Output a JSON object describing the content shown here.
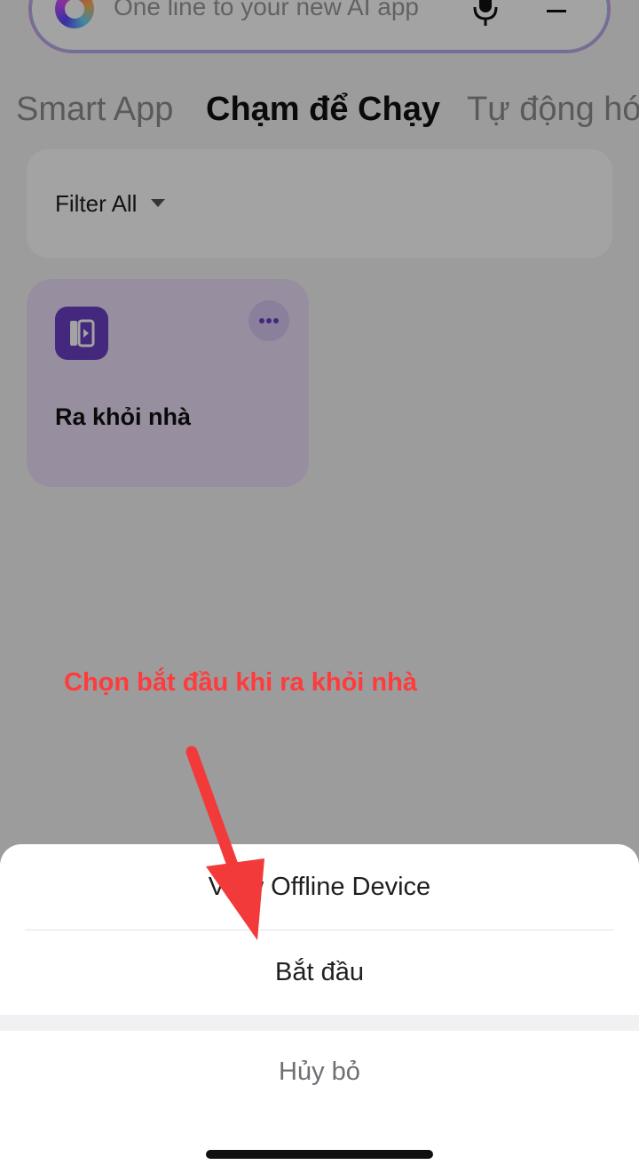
{
  "search": {
    "placeholder": "One line to your new AI app"
  },
  "tabs": [
    {
      "label": "Smart App"
    },
    {
      "label": "Chạm để Chạy"
    },
    {
      "label": "Tự động hóa"
    }
  ],
  "filter": {
    "label": "Filter All"
  },
  "shortcut": {
    "name": "Ra khỏi nhà"
  },
  "annotation": {
    "text": "Chọn bắt đầu khi ra khỏi nhà"
  },
  "sheet": {
    "option_offline": "View Offline Device",
    "option_start": "Bắt đầu",
    "cancel": "Hủy bỏ"
  },
  "colors": {
    "accent_purple": "#6a3fc4",
    "annotation_red": "#ff3b3b",
    "arrow_red": "#f23a3a"
  },
  "icons": [
    "app-logo-icon",
    "mic-icon",
    "menu-icon",
    "caret-down-icon",
    "shortcut-play-icon",
    "more-icon",
    "arrow-annotation-icon"
  ]
}
